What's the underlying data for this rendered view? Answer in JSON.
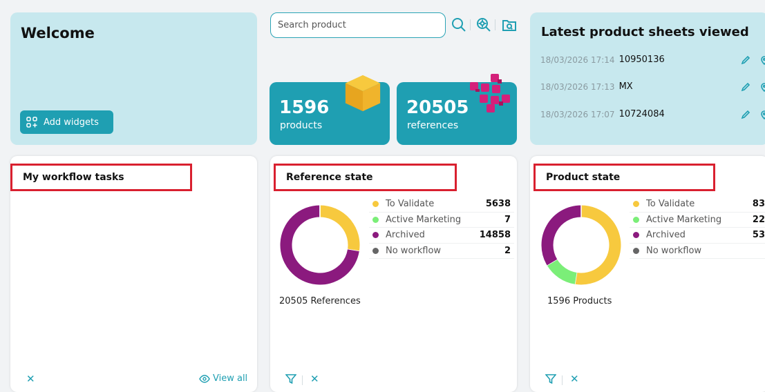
{
  "welcome": {
    "title": "Welcome",
    "add_widgets_label": "Add widgets"
  },
  "search": {
    "placeholder": "Search product"
  },
  "stats": [
    {
      "value": "1596",
      "label": "products",
      "icon": "cube-icon"
    },
    {
      "value": "20505",
      "label": "references",
      "icon": "stacked-cubes-icon"
    }
  ],
  "latest": {
    "title": "Latest product sheets viewed",
    "items": [
      {
        "timestamp": "18/03/2026 17:14",
        "code": "10950136"
      },
      {
        "timestamp": "18/03/2026 17:13",
        "code": "MX"
      },
      {
        "timestamp": "18/03/2026 17:07",
        "code": "10724084"
      }
    ]
  },
  "workflow": {
    "title": "My workflow tasks",
    "view_all_label": "View all"
  },
  "reference_state": {
    "title": "Reference state",
    "total_label": "20505 References",
    "legend": [
      {
        "label": "To Validate",
        "value": "5638",
        "color": "#f7c93e"
      },
      {
        "label": "Active Marketing",
        "value": "7",
        "color": "#7bee78"
      },
      {
        "label": "Archived",
        "value": "14858",
        "color": "#8b1a7e"
      },
      {
        "label": "No workflow",
        "value": "2",
        "color": "#666666"
      }
    ]
  },
  "product_state": {
    "title": "Product state",
    "total_label": "1596 Products",
    "legend": [
      {
        "label": "To Validate",
        "value": "83",
        "color": "#f7c93e"
      },
      {
        "label": "Active Marketing",
        "value": "22",
        "color": "#7bee78"
      },
      {
        "label": "Archived",
        "value": "53",
        "color": "#8b1a7e"
      },
      {
        "label": "No workflow",
        "value": "",
        "color": "#666666"
      }
    ]
  },
  "chart_data": [
    {
      "type": "pie",
      "categories": [
        "To Validate",
        "Active Marketing",
        "Archived",
        "No workflow"
      ],
      "values": [
        5638,
        7,
        14858,
        2
      ]
    },
    {
      "type": "pie",
      "categories": [
        "To Validate",
        "Active Marketing",
        "Archived",
        "No workflow"
      ],
      "values": [
        830,
        220,
        530,
        0
      ]
    }
  ]
}
